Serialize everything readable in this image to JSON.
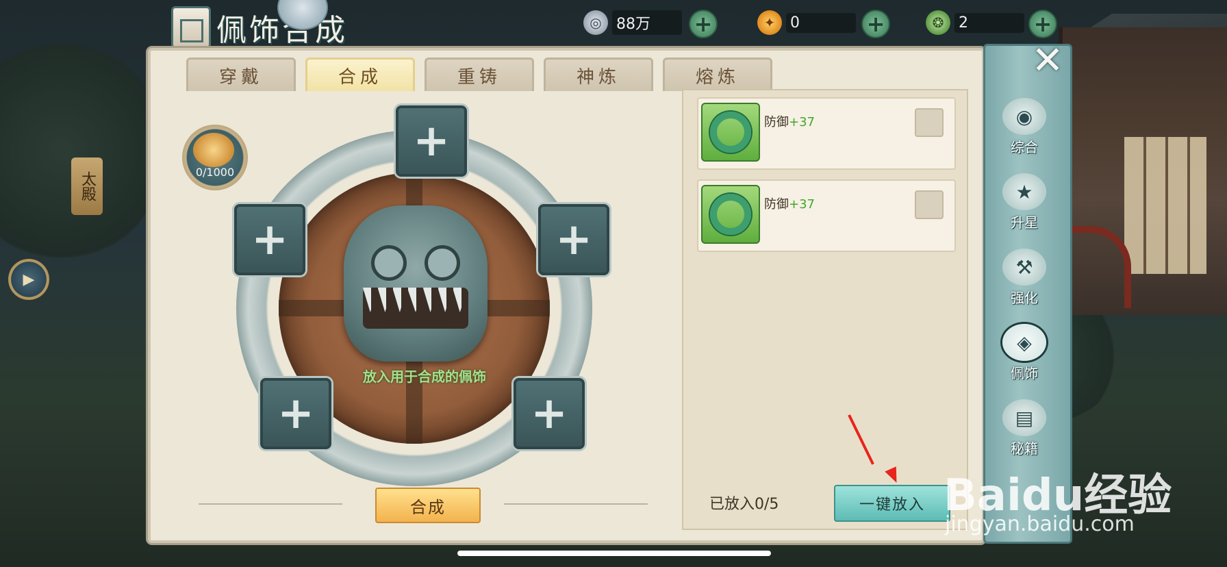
{
  "header": {
    "title": "佩饰合成"
  },
  "currencies": [
    {
      "icon": "coin-icon",
      "value": "88万"
    },
    {
      "icon": "flame-icon",
      "value": "0"
    },
    {
      "icon": "jade-token-icon",
      "value": "2"
    }
  ],
  "left_side": {
    "plaque": "太殿"
  },
  "tabs": [
    {
      "label": "穿戴",
      "active": false
    },
    {
      "label": "合成",
      "active": true
    },
    {
      "label": "重铸",
      "active": false
    },
    {
      "label": "神炼",
      "active": false
    },
    {
      "label": "熔炼",
      "active": false
    }
  ],
  "synthesis": {
    "medal_count": "0/1000",
    "hint": "放入用于合成的佩饰",
    "button": "合成"
  },
  "items": [
    {
      "name": "防御",
      "bonus": "+37",
      "icon": "jade-pendant-icon"
    },
    {
      "name": "防御",
      "bonus": "+37",
      "icon": "jade-pendant-icon"
    }
  ],
  "footer": {
    "placed": "已放入0/5",
    "auto_button": "一键放入"
  },
  "sidenav": [
    {
      "label": "综合",
      "icon": "swirl-icon",
      "active": false
    },
    {
      "label": "升星",
      "icon": "stars-icon",
      "active": false
    },
    {
      "label": "强化",
      "icon": "hammer-icon",
      "active": false
    },
    {
      "label": "佩饰",
      "icon": "pendant-icon",
      "active": true
    },
    {
      "label": "秘籍",
      "icon": "book-icon",
      "active": false
    }
  ],
  "watermark": {
    "text": "Baidu经验",
    "url": "jingyan.baidu.com"
  },
  "colors": {
    "accent_green": "#43a52e",
    "tab_active": "#f2e2a6",
    "auto_button": "#5dbcb4"
  }
}
